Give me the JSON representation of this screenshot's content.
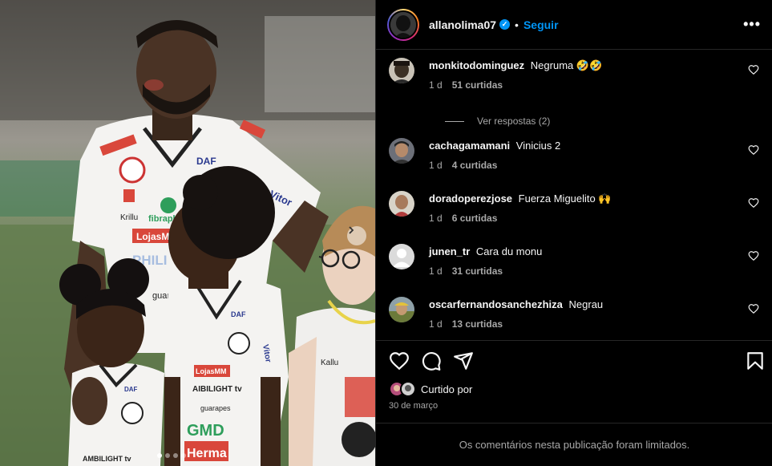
{
  "post": {
    "author": "allanolima07",
    "follow_label": "Seguir",
    "more_label": "•••",
    "separator": "•"
  },
  "comments": [
    {
      "user": "monkitodominguez",
      "text": "Negruma 🤣🤣",
      "age": "1 d",
      "likes": "51 curtidas",
      "avatar_color": "#3b3024"
    },
    {
      "user": "cachagamamani",
      "text": "Vinicius 2",
      "age": "1 d",
      "likes": "4 curtidas",
      "avatar_color": "#4a4a52"
    },
    {
      "user": "doradoperezjose",
      "text": "Fuerza Miguelito 🙌",
      "age": "1 d",
      "likes": "6 curtidas",
      "avatar_color": "#c9c3b8"
    },
    {
      "user": "junen_tr",
      "text": "Cara du monu",
      "age": "1 d",
      "likes": "31 curtidas",
      "avatar_color": "#dbdbdb"
    },
    {
      "user": "oscarfernandosanchezhiza",
      "text": "Negrau",
      "age": "1 d",
      "likes": "13 curtidas",
      "avatar_color": "#6b7a3a"
    }
  ],
  "view_replies": "Ver respostas (2)",
  "liked_by_label": "Curtido por",
  "post_date": "30 de março",
  "comments_limited": "Os comentários nesta publicação foram limitados.",
  "photo": {
    "carousel_total": 4,
    "carousel_active": 1,
    "jersey_texts": [
      "DAF",
      "Vitor",
      "fibraplac",
      "Krillu",
      "LojasMM",
      "PHILI",
      "guara",
      "DAF",
      "Vitor",
      "Kalu",
      "LojasMM",
      "AIBILIGHT tv",
      "guarapes",
      "GMD",
      "Hermes",
      "DAF",
      "Kallu",
      "AMBILIGHT tv"
    ]
  },
  "colors": {
    "accent": "#0095f6",
    "background": "#000000",
    "secondary_text": "#a8a8a8",
    "divider": "#262626"
  }
}
